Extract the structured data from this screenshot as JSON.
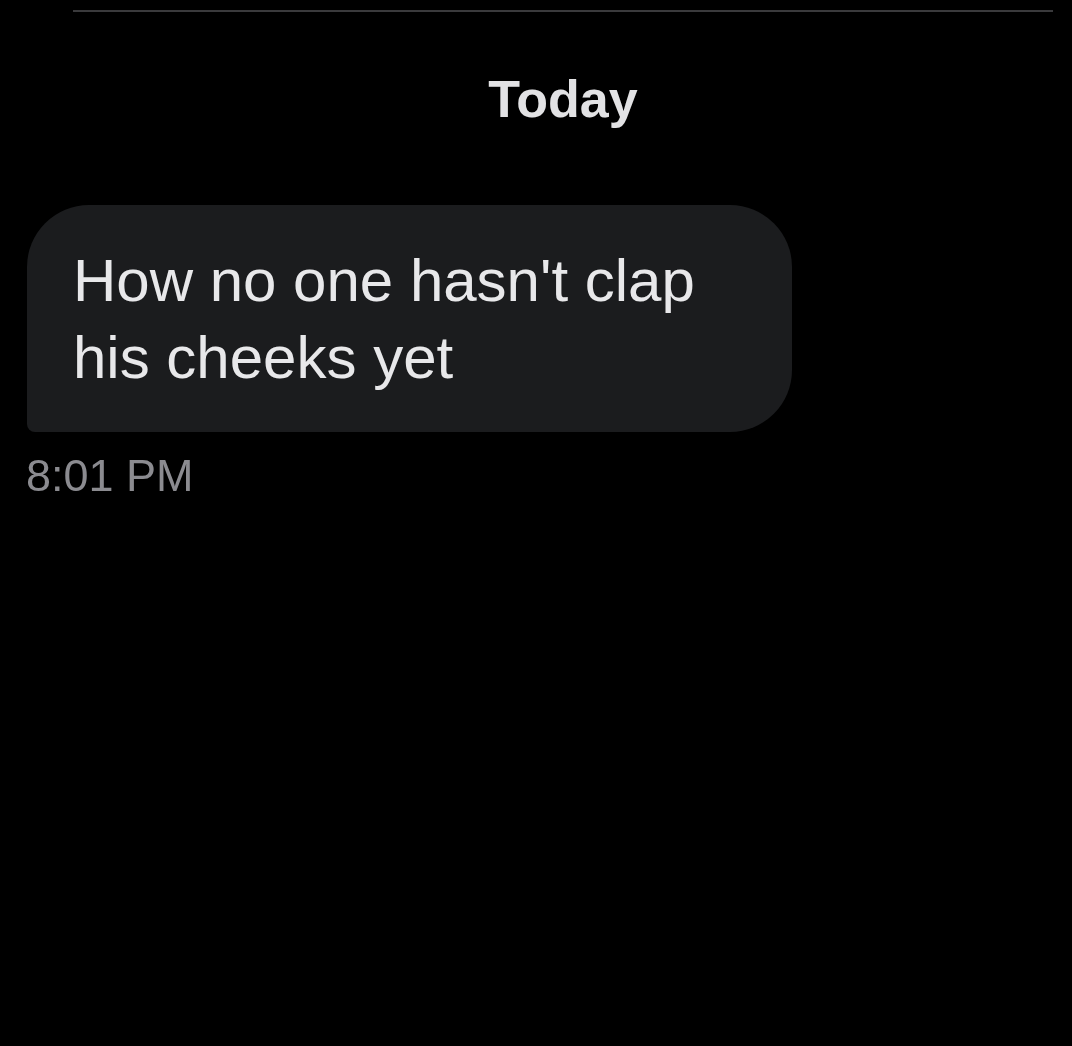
{
  "date_header": "Today",
  "messages": [
    {
      "kind": "received",
      "text": "How no one hasn't clap his cheeks yet",
      "time": "8:01 PM"
    }
  ]
}
